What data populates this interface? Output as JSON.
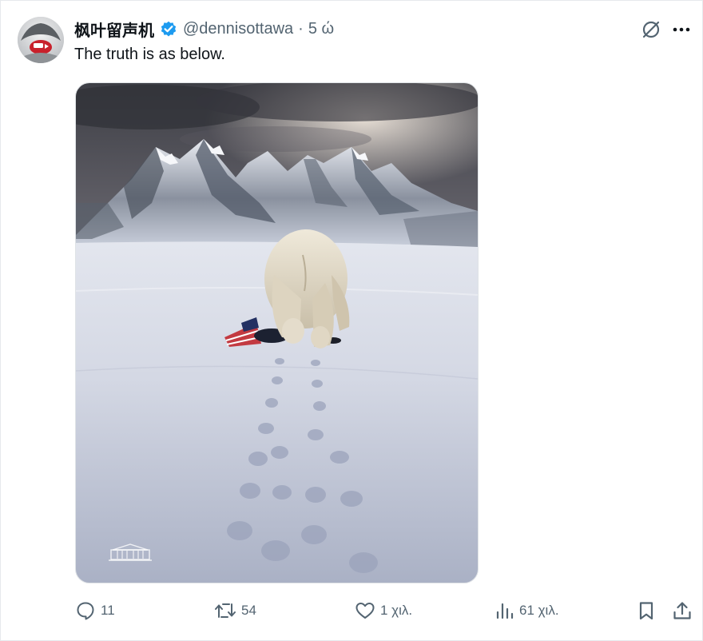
{
  "tweet": {
    "display_name": "枫叶留声机",
    "handle": "@dennisottawa",
    "separator": "·",
    "time": "5 ώ",
    "text": "The truth is as below.",
    "verified_icon": "verified-badge-icon",
    "verified_color": "#1d9bf0"
  },
  "top_actions": {
    "grok_icon": "grok-icon",
    "more_icon": "more-options-icon"
  },
  "media": {
    "image_icon": "polar-bear-photo",
    "watermark_icon": "white-house-watermark-icon"
  },
  "actions": {
    "reply": {
      "icon": "reply-icon",
      "count": "11"
    },
    "retweet": {
      "icon": "retweet-icon",
      "count": "54"
    },
    "like": {
      "icon": "heart-icon",
      "count": "1 χιλ."
    },
    "views": {
      "icon": "views-icon",
      "count": "61 χιλ."
    },
    "bookmark": {
      "icon": "bookmark-icon"
    },
    "share": {
      "icon": "share-icon"
    }
  },
  "colors": {
    "text_primary": "#0f1419",
    "text_secondary": "#536471",
    "accent": "#1d9bf0"
  }
}
